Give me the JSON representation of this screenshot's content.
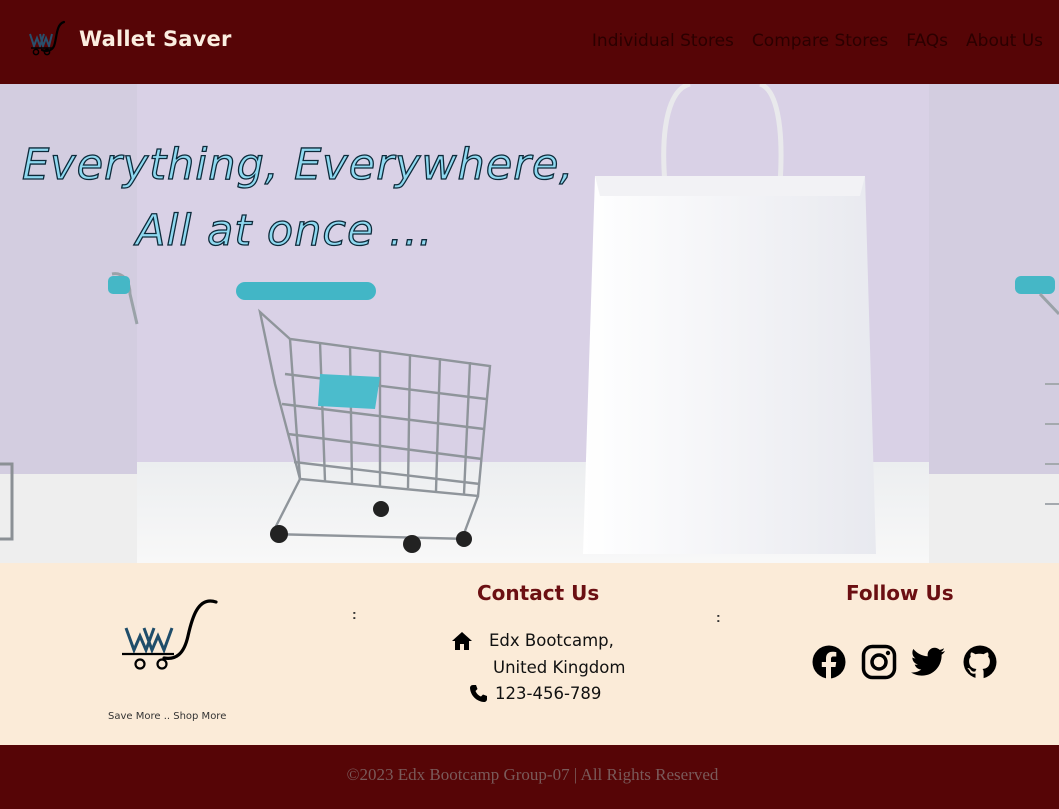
{
  "header": {
    "brand": "Wallet Saver",
    "nav": [
      "Individual Stores",
      "Compare Stores",
      "FAQs",
      "About Us"
    ]
  },
  "hero": {
    "line1": "Everything, Everywhere,",
    "line2": "All at once ..."
  },
  "footer": {
    "tagline": "Save More .. Shop More",
    "divider": ":",
    "contact": {
      "title": "Contact Us",
      "address_line1": "Edx Bootcamp,",
      "address_line2": "United Kingdom",
      "phone": "123-456-789"
    },
    "follow": {
      "title": "Follow Us",
      "icons": [
        "facebook-icon",
        "instagram-icon",
        "twitter-icon",
        "github-icon"
      ]
    },
    "copyright": "©2023 Edx Bootcamp Group-07 | All Rights Reserved"
  },
  "colors": {
    "header_bg": "#560506",
    "footer_band_bg": "#fbebd8",
    "heading": "#6b0f12",
    "hero_text": "#8fd9f0"
  }
}
